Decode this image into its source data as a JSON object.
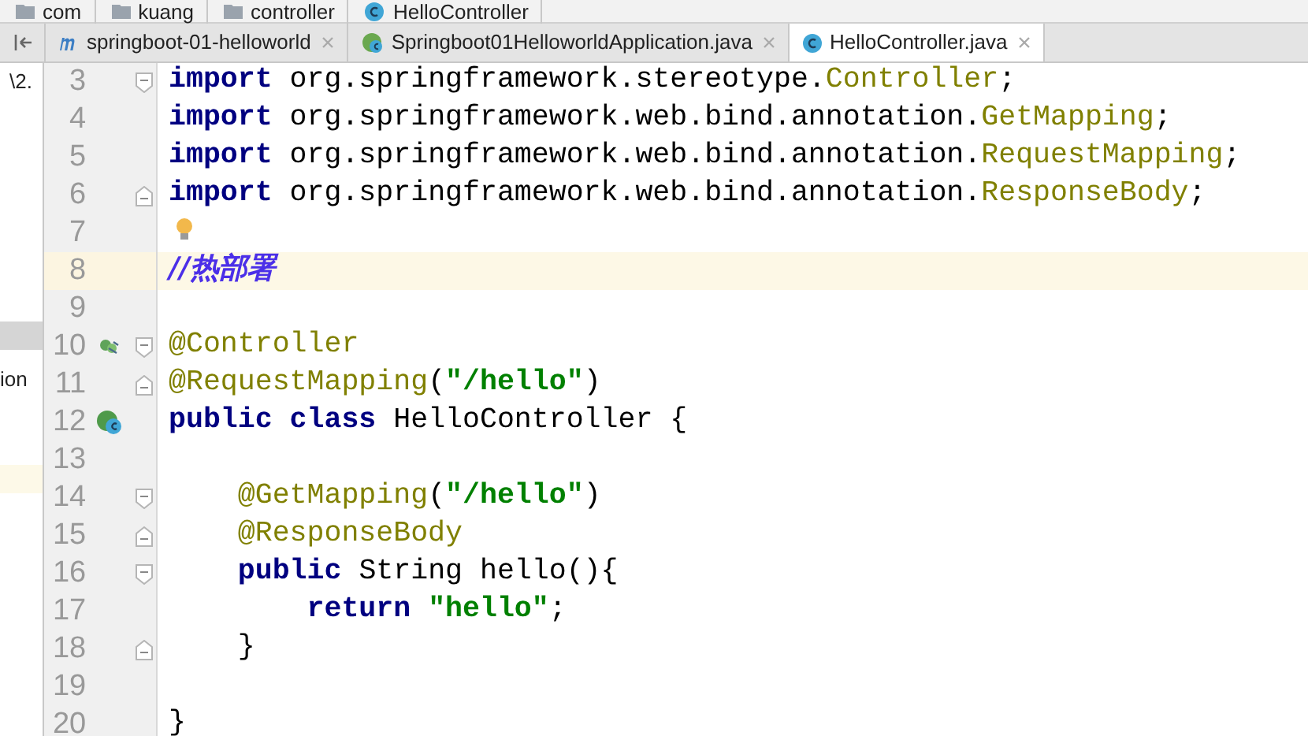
{
  "breadcrumb": [
    {
      "label": "com"
    },
    {
      "label": "kuang"
    },
    {
      "label": "controller"
    },
    {
      "label": "HelloController"
    }
  ],
  "tabs": [
    {
      "label": "springboot-01-helloworld",
      "selected": false
    },
    {
      "label": "Springboot01HelloworldApplication.java",
      "selected": false
    },
    {
      "label": "HelloController.java",
      "selected": true
    }
  ],
  "side_panel": {
    "rows": [
      {
        "text": "\\2.",
        "selected": false,
        "highlighted": false
      },
      {
        "selected": true,
        "highlighted": false
      },
      {
        "text": "ion",
        "selected": false,
        "highlighted": false
      },
      {
        "selected": false,
        "highlighted": true
      }
    ]
  },
  "editor": {
    "lines": [
      {
        "number": "3",
        "highlighted": false,
        "tokens": [
          {
            "text": "import",
            "kind": "keyword"
          },
          {
            "text": " org.springframework.stereotype.",
            "kind": "plain"
          },
          {
            "text": "Controller",
            "kind": "type"
          },
          {
            "text": ";",
            "kind": "plain"
          }
        ]
      },
      {
        "number": "4",
        "highlighted": false,
        "tokens": [
          {
            "text": "import",
            "kind": "keyword"
          },
          {
            "text": " org.springframework.web.bind.annotation.",
            "kind": "plain"
          },
          {
            "text": "GetMapping",
            "kind": "type"
          },
          {
            "text": ";",
            "kind": "plain"
          }
        ]
      },
      {
        "number": "5",
        "highlighted": false,
        "tokens": [
          {
            "text": "import",
            "kind": "keyword"
          },
          {
            "text": " org.springframework.web.bind.annotation.",
            "kind": "plain"
          },
          {
            "text": "RequestMapping",
            "kind": "type"
          },
          {
            "text": ";",
            "kind": "plain"
          }
        ]
      },
      {
        "number": "6",
        "highlighted": false,
        "tokens": [
          {
            "text": "import",
            "kind": "keyword"
          },
          {
            "text": " org.springframework.web.bind.annotation.",
            "kind": "plain"
          },
          {
            "text": "ResponseBody",
            "kind": "type"
          },
          {
            "text": ";",
            "kind": "plain"
          }
        ]
      },
      {
        "number": "7",
        "highlighted": false
      },
      {
        "number": "8",
        "highlighted": true,
        "tokens": [
          {
            "text": "//热部署",
            "kind": "comment"
          }
        ]
      },
      {
        "number": "9",
        "highlighted": false
      },
      {
        "number": "10",
        "highlighted": false,
        "tokens": [
          {
            "text": "@Controller",
            "kind": "annotation"
          }
        ]
      },
      {
        "number": "11",
        "highlighted": false,
        "tokens": [
          {
            "text": "@RequestMapping",
            "kind": "annotation"
          },
          {
            "text": "(",
            "kind": "plain"
          },
          {
            "text": "\"/hello\"",
            "kind": "string"
          },
          {
            "text": ")",
            "kind": "plain"
          }
        ]
      },
      {
        "number": "12",
        "highlighted": false,
        "tokens": [
          {
            "text": "public class",
            "kind": "keyword"
          },
          {
            "text": " HelloController {",
            "kind": "plain"
          }
        ]
      },
      {
        "number": "13",
        "highlighted": false
      },
      {
        "number": "14",
        "highlighted": false,
        "tokens": [
          {
            "text": "    @GetMapping",
            "kind": "annotation"
          },
          {
            "text": "(",
            "kind": "plain"
          },
          {
            "text": "\"/hello\"",
            "kind": "string"
          },
          {
            "text": ")",
            "kind": "plain"
          }
        ]
      },
      {
        "number": "15",
        "highlighted": false,
        "tokens": [
          {
            "text": "    @ResponseBody",
            "kind": "annotation"
          }
        ]
      },
      {
        "number": "16",
        "highlighted": false,
        "tokens": [
          {
            "text": "    public",
            "kind": "keyword"
          },
          {
            "text": " String hello(){",
            "kind": "plain"
          }
        ]
      },
      {
        "number": "17",
        "highlighted": false,
        "tokens": [
          {
            "text": "        return",
            "kind": "keyword"
          },
          {
            "text": " \"hello\"",
            "kind": "string"
          },
          {
            "text": ";",
            "kind": "plain"
          }
        ]
      },
      {
        "number": "18",
        "highlighted": false,
        "tokens": [
          {
            "text": "    }",
            "kind": "plain"
          }
        ]
      },
      {
        "number": "19",
        "highlighted": false
      },
      {
        "number": "20",
        "highlighted": false,
        "tokens": [
          {
            "text": "}",
            "kind": "plain"
          }
        ]
      }
    ]
  }
}
